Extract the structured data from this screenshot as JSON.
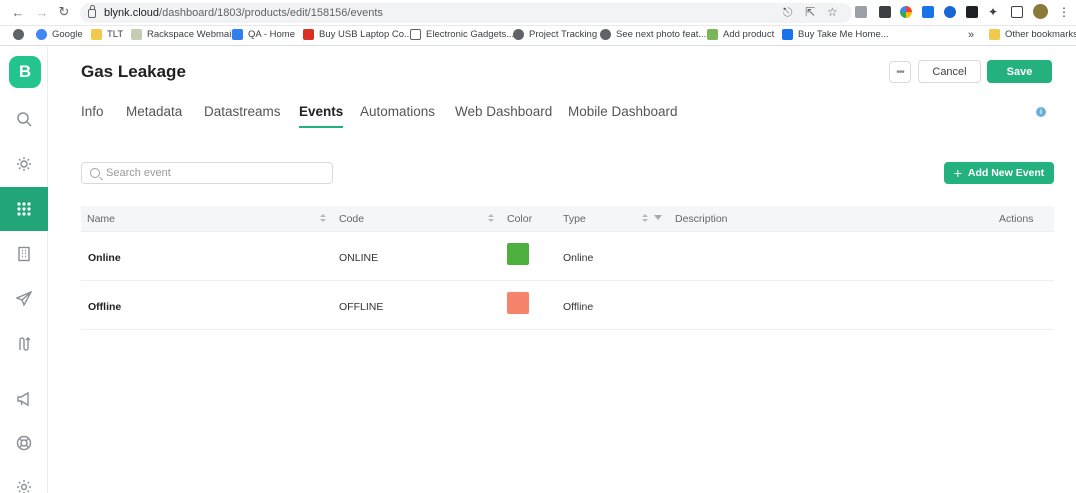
{
  "browser": {
    "url_host": "blynk.cloud",
    "url_path": "/dashboard/1803/products/edit/158156/events",
    "bookmarks": [
      {
        "label": "Google",
        "icon": "google-icon",
        "color": "#4285f4"
      },
      {
        "label": "TLT",
        "icon": "folder-icon",
        "color": "#f2c94c"
      },
      {
        "label": "Rackspace Webmail",
        "icon": "mail-icon",
        "color": "#9aa0a6"
      },
      {
        "label": "QA - Home",
        "icon": "qa-icon",
        "color": "#2f80ed"
      },
      {
        "label": "Buy USB Laptop Co...",
        "icon": "store-icon",
        "color": "#d93025"
      },
      {
        "label": "Electronic Gadgets...",
        "icon": "calendar-icon",
        "color": "#5f6368"
      },
      {
        "label": "Project Tracking",
        "icon": "globe-icon",
        "color": "#5f6368"
      },
      {
        "label": "See next photo feat...",
        "icon": "globe-icon",
        "color": "#5f6368"
      },
      {
        "label": "Add product",
        "icon": "shopify-icon",
        "color": "#7ab55c"
      },
      {
        "label": "Buy Take Me Home...",
        "icon": "store-icon",
        "color": "#1a73e8"
      }
    ],
    "more_bookmarks": "»",
    "other_bookmarks": "Other bookmarks"
  },
  "sidebar": {
    "logo": "B",
    "items": [
      {
        "name": "search",
        "icon": "search-icon"
      },
      {
        "name": "developer-zone",
        "icon": "sun-icon"
      },
      {
        "name": "products",
        "icon": "grid-icon",
        "active": true
      },
      {
        "name": "organizations",
        "icon": "building-icon"
      },
      {
        "name": "in-app-messaging",
        "icon": "paper-plane-icon"
      },
      {
        "name": "automations",
        "icon": "flow-icon"
      },
      {
        "name": "announcements",
        "icon": "megaphone-icon"
      },
      {
        "name": "support",
        "icon": "lifebuoy-icon"
      },
      {
        "name": "settings",
        "icon": "gear-icon"
      }
    ]
  },
  "header": {
    "title": "Gas Leakage",
    "more_label": "•••",
    "cancel_label": "Cancel",
    "save_label": "Save",
    "info_label": "i"
  },
  "tabs": [
    {
      "label": "Info"
    },
    {
      "label": "Metadata"
    },
    {
      "label": "Datastreams"
    },
    {
      "label": "Events",
      "active": true
    },
    {
      "label": "Automations"
    },
    {
      "label": "Web Dashboard"
    },
    {
      "label": "Mobile Dashboard"
    }
  ],
  "search": {
    "placeholder": "Search event"
  },
  "add_button": {
    "plus": "+",
    "label": "Add New Event"
  },
  "table": {
    "columns": [
      "Name",
      "Code",
      "Color",
      "Type",
      "Description",
      "Actions"
    ],
    "rows": [
      {
        "name": "Online",
        "code": "ONLINE",
        "color": "#4caf3e",
        "type": "Online",
        "description": ""
      },
      {
        "name": "Offline",
        "code": "OFFLINE",
        "color": "#f6836b",
        "type": "Offline",
        "description": ""
      }
    ]
  },
  "colors": {
    "accent": "#23b17d",
    "sidebar_active": "#23a57a"
  }
}
